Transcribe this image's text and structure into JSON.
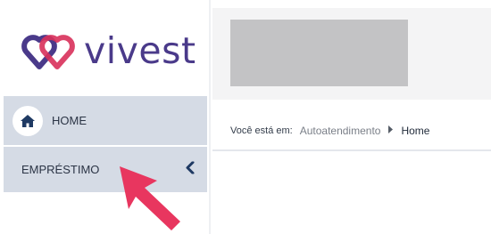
{
  "brand": {
    "name": "vivest",
    "logo_icon": "interlocking-hearts-logo",
    "accent_color": "#d8305a",
    "primary_color": "#4a3a8a"
  },
  "sidebar": {
    "items": [
      {
        "label": "HOME",
        "icon": "home-icon"
      },
      {
        "label": "EMPRÉSTIMO",
        "icon": "chevron-left-icon"
      }
    ]
  },
  "breadcrumb": {
    "prefix": "Você está em:",
    "items": [
      "Autoatendimento",
      "Home"
    ],
    "separator_icon": "chevron-right-icon"
  },
  "cursor": {
    "icon": "pointer-arrow-icon",
    "color": "#e8365f"
  }
}
